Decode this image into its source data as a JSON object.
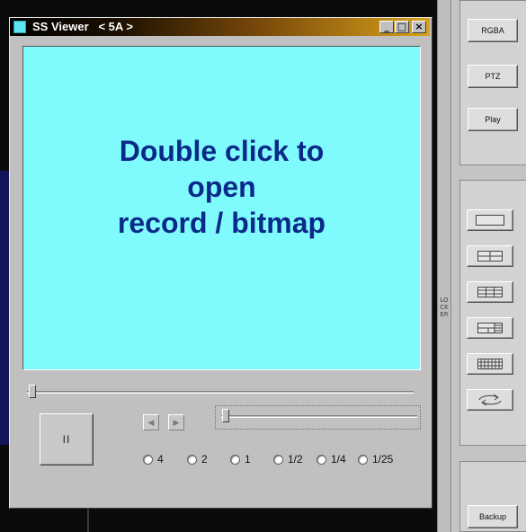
{
  "viewer": {
    "title": "SS Viewer   < 5A >",
    "minimize": "_",
    "maximize": "□",
    "close": "×",
    "viewport_lines": [
      "Double click to",
      "open",
      "record / bitmap"
    ],
    "pause_label": "II",
    "prev_arrow": "◀",
    "next_arrow": "▶",
    "speeds": [
      "4",
      "2",
      "1",
      "1/2",
      "1/4",
      "1/25"
    ]
  },
  "panel": {
    "buttons": {
      "rgba": "RGBA",
      "ptz": "PTZ",
      "play": "Play",
      "backup": "Backup"
    },
    "locker_label": "LOCKER",
    "layouts": [
      "single-layout-icon",
      "quad-layout-icon",
      "six-layout-icon",
      "eight-layout-icon",
      "sixteen-layout-icon",
      "rotate-icon"
    ]
  },
  "colors": {
    "viewport_bg": "#80fbfd",
    "viewport_text": "#0a2a8a",
    "title_gradient_end": "#d9a21b",
    "app_icon": "#5fe3f0"
  }
}
